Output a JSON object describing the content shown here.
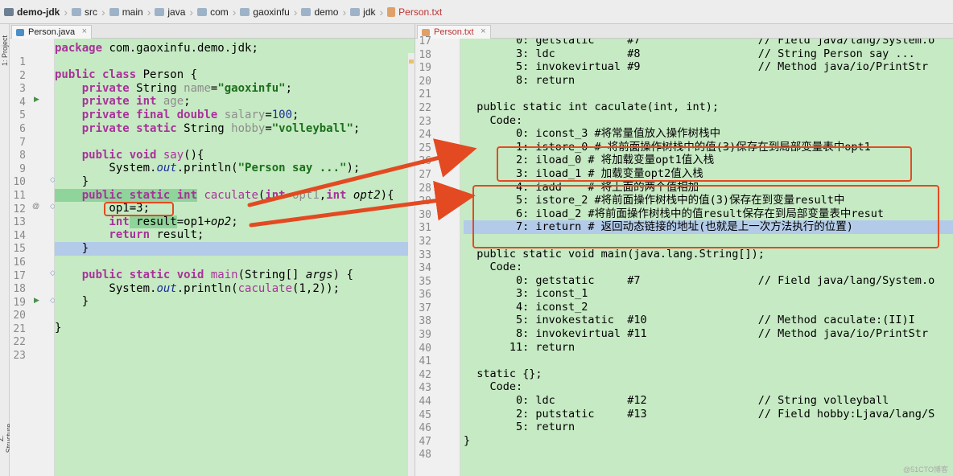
{
  "breadcrumb": [
    {
      "label": "demo-jdk",
      "icon": "module-icon"
    },
    {
      "label": "src",
      "icon": "folder-icon"
    },
    {
      "label": "main",
      "icon": "folder-icon"
    },
    {
      "label": "java",
      "icon": "folder-icon"
    },
    {
      "label": "com",
      "icon": "package-icon"
    },
    {
      "label": "gaoxinfu",
      "icon": "package-icon"
    },
    {
      "label": "demo",
      "icon": "package-icon"
    },
    {
      "label": "jdk",
      "icon": "package-icon"
    },
    {
      "label": "Person.txt",
      "icon": "text-file-icon"
    }
  ],
  "sidebar": {
    "project_label": "1: Project",
    "structure_label": "Z: Structure"
  },
  "left_editor": {
    "tab_label": "Person.java",
    "line_numbers": [
      "1",
      "2",
      "3",
      "4",
      "5",
      "6",
      "7",
      "8",
      "9",
      "10",
      "11",
      "12",
      "13",
      "14",
      "15",
      "16",
      "17",
      "18",
      "19",
      "20",
      "21",
      "22",
      "23"
    ]
  },
  "right_editor": {
    "tab_label": "Person.txt",
    "line_numbers": [
      "17",
      "18",
      "19",
      "20",
      "21",
      "22",
      "23",
      "24",
      "25",
      "26",
      "27",
      "28",
      "29",
      "30",
      "31",
      "32",
      "33",
      "34",
      "35",
      "36",
      "37",
      "38",
      "39",
      "40",
      "41",
      "42",
      "43",
      "44",
      "45",
      "46",
      "47",
      "48"
    ]
  },
  "java_code": {
    "l1a": "package",
    "l1b": " com.gaoxinfu.demo.jdk;",
    "l3a": "public class",
    "l3b": " Person {",
    "l4a": "    private",
    "l4b": " String ",
    "l4c": "name",
    "l4d": "=",
    "l4e": "\"gaoxinfu\"",
    "l4f": ";",
    "l5a": "    private int",
    "l5b": " age",
    "l5c": ";",
    "l6a": "    private final double",
    "l6b": " salary",
    "l6c": "=",
    "l6d": "100",
    "l6e": ";",
    "l7a": "    private static",
    "l7b": " String ",
    "l7c": "hobby",
    "l7d": "=",
    "l7e": "\"volleyball\"",
    "l7f": ";",
    "l9a": "    public void",
    "l9b": " say",
    "l9c": "(){",
    "l10a": "        System.",
    "l10b": "out",
    "l10c": ".println(",
    "l10d": "\"Person say ...\"",
    "l10e": ");",
    "l11": "    }",
    "l12a": "    public static int",
    "l12b": " caculate",
    "l12c": "(",
    "l12d": "int",
    "l12e": " opt1",
    "l12f": ",",
    "l12g": "int",
    "l12h": " opt2",
    "l12i": "){",
    "l13": "        op1=3;",
    "l14a": "        int",
    "l14b": " result",
    "l14c": "=op1+",
    "l14d": "op2",
    "l14e": ";",
    "l15a": "        return",
    "l15b": " result",
    "l15c": ";",
    "l16": "    }",
    "l18a": "    public static void",
    "l18b": " main",
    "l18c": "(String[] ",
    "l18d": "args",
    "l18e": ") {",
    "l19a": "        System.",
    "l19b": "out",
    "l19c": ".println(",
    "l19d": "caculate",
    "l19e": "(1,2));",
    "l20": "    }",
    "l22": "}"
  },
  "bytecode": {
    "r17": "        0: getstatic     #7                  // Field java/lang/System.o",
    "r18": "        3: ldc           #8                  // String Person say ...",
    "r19": "        5: invokevirtual #9                  // Method java/io/PrintStr",
    "r20": "        8: return",
    "r21": "",
    "r22": "  public static int caculate(int, int);",
    "r23": "    Code:",
    "r24": "        0: iconst_3 #将常量值放入操作树栈中",
    "r25": "        1: istore_0 # 将前面操作树栈中的值(3)保存在到局部变量表中opt1",
    "r26": "        2: iload_0 # 将加载变量opt1值入栈",
    "r27": "        3: iload_1 # 加载变量opt2值入栈",
    "r28": "        4: iadd    # 将上面的两个值相加",
    "r29": "        5: istore_2 #将前面操作树栈中的值(3)保存在到变量result中",
    "r30": "        6: iload_2 #将前面操作树栈中的值result保存在到局部变量表中resut",
    "r31": "        7: ireturn # 返回动态链接的地址(也就是上一次方法执行的位置)",
    "r32": "",
    "r33": "  public static void main(java.lang.String[]);",
    "r34": "    Code:",
    "r35": "        0: getstatic     #7                  // Field java/lang/System.o",
    "r36": "        3: iconst_1",
    "r37": "        4: iconst_2",
    "r38": "        5: invokestatic  #10                 // Method caculate:(II)I",
    "r39": "        8: invokevirtual #11                 // Method java/io/PrintStr",
    "r40": "       11: return",
    "r41": "",
    "r42": "  static {};",
    "r43": "    Code:",
    "r44": "        0: ldc           #12                 // String volleyball",
    "r45": "        2: putstatic     #13                 // Field hobby:Ljava/lang/S",
    "r46": "        5: return",
    "r47": "}",
    "r48": ""
  },
  "watermark": "@51CTO博客",
  "colors": {
    "annotation": "#e34a22",
    "code_bg": "#c6eac3",
    "current_line": "#b3cbe8"
  }
}
